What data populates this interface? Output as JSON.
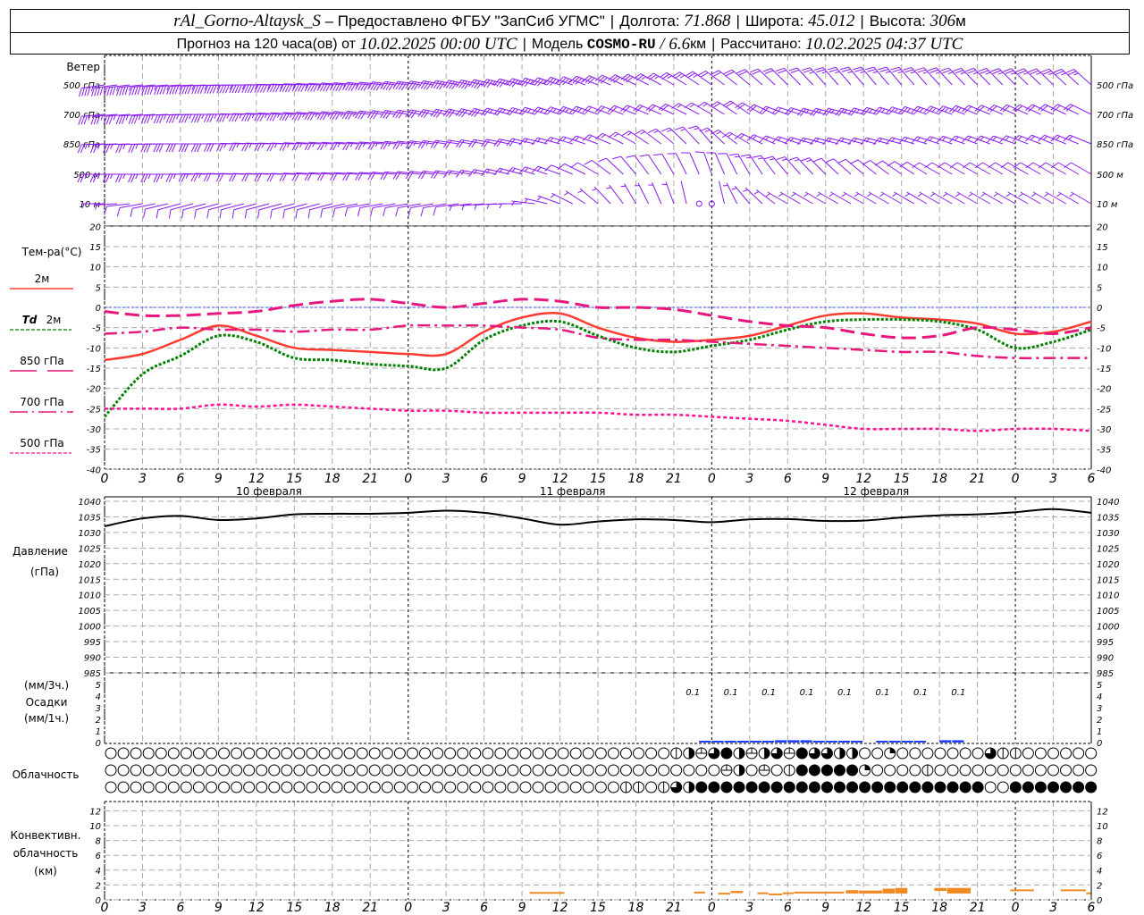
{
  "header": {
    "station": "rAl_Gorno-Altaysk_S",
    "provider": " – Предоставлено ФГБУ \"ЗапСиб УГМС\"",
    "lon_label": "Долгота: ",
    "lon": "71.868",
    "lat_label": "Широта: ",
    "lat": "45.012",
    "alt_label": "Высота: ",
    "alt": "306",
    "alt_unit": "м",
    "forecast_label": "Прогноз на 120 часа(ов) от ",
    "forecast_start": "10.02.2025 00:00 UTC",
    "model_label": "Модель ",
    "model": "COSMO-RU",
    "model_sep": " / ",
    "resolution": "6.6",
    "resolution_unit": "км",
    "calc_label": "Рассчитано: ",
    "calc_time": "10.02.2025 04:37 UTC",
    "separator": "|"
  },
  "labels": {
    "wind": "Ветер",
    "levels": [
      "500 гПа",
      "700 гПа",
      "850 гПа",
      "500 м",
      "10  м"
    ],
    "temp_title": "Тем-ра(°C)",
    "t2m": "2м",
    "td_a": "Td",
    "td_b": "2м",
    "t850": "850 гПа",
    "t700": "700 гПа",
    "t500": "500 гПа",
    "pressure": "Давление",
    "pressure_unit": "(гПа)",
    "precip_3h": "(мм/3ч.)",
    "precip": "Осадки",
    "precip_1h": "(мм/1ч.)",
    "cloud": "Облачность",
    "conv_a": "Конвективн.",
    "conv_b": "облачность",
    "conv_c": "(км)"
  },
  "colors": {
    "t2m": "#ff3b30",
    "td": "#008000",
    "t850": "#e8177e",
    "t700": "#e8177e",
    "t500": "#ff1493",
    "pressure": "#000000",
    "precip": "#1f3fff",
    "conv": "#f08a24",
    "wind": "#8a1cf0"
  },
  "chart_data": {
    "type": "line",
    "title": "Meteogram",
    "hours_step": 3,
    "x_ticks": [
      "0",
      "3",
      "6",
      "9",
      "12",
      "15",
      "18",
      "21",
      "0",
      "3",
      "6",
      "9",
      "12",
      "15",
      "18",
      "21",
      "0",
      "3",
      "6",
      "9",
      "12",
      "15",
      "18",
      "21",
      "0",
      "3",
      "6"
    ],
    "dates": [
      "10 февраля",
      "11 февраля",
      "12 февраля"
    ],
    "temperature": {
      "ylim": [
        -40,
        20
      ],
      "y_ticks": [
        "20",
        "15",
        "10",
        "5",
        "0",
        "-5",
        "-10",
        "-15",
        "-20",
        "-25",
        "-30",
        "-35",
        "-40"
      ],
      "series": [
        {
          "name": "2м",
          "key": "t2m",
          "values": [
            -13,
            -11.5,
            -8,
            -4.5,
            -7,
            -10,
            -10.5,
            -11,
            -11.5,
            -11.5,
            -6,
            -2.5,
            -1.5,
            -5,
            -7.5,
            -8.5,
            -8,
            -7,
            -4.5,
            -2,
            -1.5,
            -2.5,
            -3,
            -4,
            -6.5,
            -6,
            -3.5
          ]
        },
        {
          "name": "Td 2м",
          "key": "td",
          "values": [
            -27,
            -16.5,
            -12,
            -7,
            -8.5,
            -12.5,
            -13,
            -14,
            -14.5,
            -15,
            -8,
            -4.5,
            -3.5,
            -7,
            -10,
            -11,
            -9.5,
            -8,
            -5.5,
            -3.5,
            -3,
            -3,
            -3.5,
            -5.5,
            -10,
            -8.5,
            -5.5
          ]
        },
        {
          "name": "850 гПа",
          "key": "t850",
          "values": [
            -1,
            -2,
            -2,
            -1.5,
            -1,
            0.5,
            1.5,
            2,
            1,
            0,
            1,
            2,
            1.5,
            0,
            0,
            -0.5,
            -2,
            -3.5,
            -4.5,
            -5,
            -6.5,
            -7.5,
            -7,
            -5,
            -5.5,
            -6.5,
            -5
          ]
        },
        {
          "name": "700 гПа",
          "key": "t700",
          "values": [
            -6.5,
            -6,
            -5,
            -5.5,
            -5.5,
            -6,
            -5.5,
            -5.5,
            -4.5,
            -4.5,
            -4.5,
            -5,
            -5.5,
            -7.5,
            -8,
            -8,
            -8.5,
            -9,
            -9.5,
            -10,
            -10.5,
            -11,
            -11,
            -12,
            -12.5,
            -12.5,
            -12.5
          ]
        },
        {
          "name": "500 гПа",
          "key": "t500",
          "values": [
            -25,
            -25,
            -25,
            -24,
            -24.5,
            -24,
            -24.5,
            -25,
            -25.5,
            -25.5,
            -26,
            -26,
            -26,
            -26,
            -26.5,
            -26.5,
            -27,
            -27.5,
            -28,
            -29,
            -30,
            -30,
            -30,
            -30.5,
            -30,
            -30,
            -30.5
          ]
        }
      ]
    },
    "pressure": {
      "ylim": [
        985,
        1040
      ],
      "y_ticks": [
        "1040",
        "1035",
        "1030",
        "1025",
        "1020",
        "1015",
        "1010",
        "1005",
        "1000",
        "995",
        "990",
        "985"
      ],
      "values": [
        1032,
        1034.5,
        1035.3,
        1034,
        1034.5,
        1035.8,
        1036,
        1036,
        1036.3,
        1037,
        1036.3,
        1034.5,
        1032.5,
        1033.5,
        1034.2,
        1034,
        1033.3,
        1034.2,
        1034.3,
        1033.7,
        1033.8,
        1034.8,
        1035.5,
        1035.8,
        1036.5,
        1037.5,
        1036.3
      ]
    },
    "precipitation": {
      "ylim": [
        0,
        5
      ],
      "y_ticks": [
        "5",
        "4",
        "3",
        "2",
        "1",
        "0"
      ],
      "totals_3h": [
        {
          "start_hour": 45,
          "value": "0.1"
        },
        {
          "start_hour": 48,
          "value": "0.1"
        },
        {
          "start_hour": 51,
          "value": "0.1"
        },
        {
          "start_hour": 54,
          "value": "0.1"
        },
        {
          "start_hour": 57,
          "value": "0.1"
        },
        {
          "start_hour": 60,
          "value": "0.1"
        },
        {
          "start_hour": 63,
          "value": "0.1"
        },
        {
          "start_hour": 66,
          "value": "0.1"
        }
      ],
      "hourly_start": 47,
      "hourly": [
        0.1,
        0.1,
        0.1,
        0.1,
        0.1,
        0.1,
        0.2,
        0.2,
        0.2,
        0.1,
        0.1,
        0.1,
        0.1,
        0,
        0.1,
        0.1,
        0.1,
        0.1,
        0,
        0.2,
        0.2
      ]
    },
    "cloud_cover_legend": {
      "0": "clear",
      "1": "quarter",
      "h": "few",
      "v": "few-vertical",
      "2": "half",
      "3": "three-quarters",
      "4": "overcast"
    },
    "cloud_cover_rows": [
      [
        [
          "0",
          45
        ],
        [
          "v",
          1
        ],
        [
          "2",
          1
        ],
        [
          "h",
          1
        ],
        [
          "3",
          1
        ],
        [
          "4",
          1
        ],
        [
          "2",
          1
        ],
        [
          "h",
          1
        ],
        [
          "2",
          1
        ],
        [
          "3",
          1
        ],
        [
          "h",
          1
        ],
        [
          "4",
          1
        ],
        [
          "3",
          1
        ],
        [
          "3",
          1
        ],
        [
          "2",
          1
        ],
        [
          "2",
          1
        ],
        [
          "0",
          2
        ],
        [
          "1",
          1
        ],
        [
          "0",
          7
        ],
        [
          "3",
          1
        ],
        [
          "v",
          2
        ],
        [
          "0",
          6
        ]
      ],
      [
        [
          "0",
          49
        ],
        [
          "h",
          1
        ],
        [
          "2",
          1
        ],
        [
          "0",
          1
        ],
        [
          "h",
          1
        ],
        [
          "0",
          1
        ],
        [
          "v",
          1
        ],
        [
          "4",
          5
        ],
        [
          "1",
          1
        ],
        [
          "0",
          4
        ],
        [
          "v",
          1
        ],
        [
          "0",
          13
        ]
      ],
      [
        [
          "0",
          41
        ],
        [
          "v",
          2
        ],
        [
          "0",
          1
        ],
        [
          "v",
          1
        ],
        [
          "3",
          1
        ],
        [
          "2",
          1
        ],
        [
          "4",
          23
        ],
        [
          "0",
          2
        ],
        [
          "4",
          7
        ]
      ]
    ],
    "convective_cloud": {
      "ylim": [
        0,
        13
      ],
      "y_ticks": [
        "12",
        "10",
        "8",
        "6",
        "4",
        "2",
        "0"
      ],
      "segments": [
        [
          33.6,
          36.4,
          0.9,
          1.05
        ],
        [
          46.6,
          47.5,
          0.85,
          1.1
        ],
        [
          48.5,
          49.5,
          0.85,
          0.95
        ],
        [
          49.5,
          50.5,
          0.9,
          1.2
        ],
        [
          51.6,
          52.5,
          0.9,
          1.0
        ],
        [
          52.5,
          53.6,
          0.75,
          0.85
        ],
        [
          53.6,
          54.5,
          0.8,
          1.0
        ],
        [
          54.5,
          58.5,
          0.85,
          1.1
        ],
        [
          58.6,
          59.6,
          0.85,
          1.3
        ],
        [
          59.6,
          61.5,
          0.85,
          1.25
        ],
        [
          61.5,
          62.5,
          0.85,
          1.5
        ],
        [
          62.5,
          63.5,
          0.85,
          1.6
        ],
        [
          65.6,
          66.6,
          1.2,
          1.6
        ],
        [
          66.6,
          68.5,
          0.85,
          1.6
        ],
        [
          71.6,
          73.5,
          1.2,
          1.4
        ],
        [
          75.6,
          77.6,
          1.2,
          1.4
        ],
        [
          77.6,
          78,
          0.85,
          1.0
        ]
      ]
    },
    "wind": [
      {
        "level": "500 гПа",
        "dir": [
          262,
          264,
          266,
          268,
          270,
          272,
          274,
          276,
          278,
          280,
          282,
          285,
          288,
          292,
          296,
          300,
          305,
          310,
          315,
          318,
          320,
          320,
          318,
          316,
          315,
          314,
          312
        ],
        "speed": [
          22,
          23,
          24,
          24,
          24,
          23,
          23,
          22,
          22,
          21,
          20,
          19,
          18,
          17,
          15,
          14,
          12,
          11,
          11,
          12,
          12,
          13,
          13,
          14,
          14,
          13,
          13
        ]
      },
      {
        "level": "700 гПа",
        "dir": [
          265,
          266,
          268,
          270,
          272,
          274,
          276,
          278,
          280,
          282,
          284,
          286,
          288,
          290,
          292,
          295,
          300,
          305,
          290,
          285,
          285,
          288,
          290,
          292,
          294,
          295,
          296
        ],
        "speed": [
          18,
          18,
          19,
          19,
          18,
          18,
          17,
          17,
          16,
          16,
          15,
          14,
          13,
          12,
          11,
          10,
          9,
          10,
          11,
          12,
          12,
          12,
          12,
          12,
          11,
          11,
          11
        ]
      },
      {
        "level": "850 гПа",
        "dir": [
          268,
          268,
          270,
          270,
          272,
          272,
          274,
          274,
          276,
          278,
          280,
          282,
          285,
          290,
          300,
          310,
          320,
          300,
          290,
          285,
          285,
          285,
          288,
          290,
          290,
          292,
          292
        ],
        "speed": [
          14,
          14,
          15,
          15,
          14,
          14,
          13,
          13,
          12,
          12,
          11,
          10,
          9,
          8,
          7,
          7,
          8,
          9,
          9,
          9,
          9,
          8,
          8,
          8,
          8,
          8,
          8
        ]
      },
      {
        "level": "500 м",
        "dir": [
          270,
          270,
          270,
          272,
          272,
          272,
          274,
          274,
          276,
          278,
          280,
          285,
          290,
          300,
          320,
          330,
          340,
          330,
          320,
          315,
          310,
          305,
          300,
          300,
          300,
          300,
          300
        ],
        "speed": [
          12,
          12,
          12,
          12,
          11,
          11,
          11,
          10,
          10,
          10,
          9,
          8,
          7,
          6,
          5,
          5,
          6,
          7,
          7,
          7,
          6,
          6,
          6,
          6,
          5,
          5,
          5
        ]
      },
      {
        "level": "10 м",
        "dir": [
          270,
          260,
          255,
          255,
          255,
          255,
          255,
          260,
          260,
          260,
          265,
          270,
          290,
          310,
          330,
          340,
          360,
          320,
          300,
          300,
          300,
          300,
          300,
          300,
          300,
          300,
          300
        ],
        "speed": [
          3,
          6,
          6,
          6,
          5,
          5,
          5,
          5,
          5,
          5,
          4,
          4,
          4,
          3,
          3,
          2,
          1,
          3,
          3,
          3,
          3,
          3,
          3,
          3,
          3,
          3,
          3
        ]
      }
    ]
  }
}
